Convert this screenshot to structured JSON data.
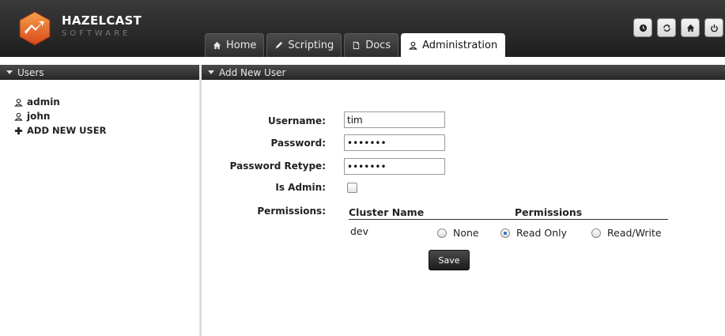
{
  "brand": {
    "name": "HAZELCAST",
    "subtitle": "SOFTWARE"
  },
  "tabs": [
    {
      "label": "Home",
      "icon": "home-icon",
      "active": false
    },
    {
      "label": "Scripting",
      "icon": "pencil-icon",
      "active": false
    },
    {
      "label": "Docs",
      "icon": "document-icon",
      "active": false
    },
    {
      "label": "Administration",
      "icon": "user-icon",
      "active": true
    }
  ],
  "header_buttons": [
    "clock-icon",
    "refresh-icon",
    "home-icon",
    "power-icon"
  ],
  "sidebar": {
    "title": "Users",
    "items": [
      {
        "label": "admin",
        "icon": "user-icon"
      },
      {
        "label": "john",
        "icon": "user-icon"
      },
      {
        "label": "ADD NEW USER",
        "icon": "plus-icon"
      }
    ]
  },
  "main": {
    "title": "Add New User",
    "form": {
      "username_label": "Username:",
      "username_value": "tim",
      "password_label": "Password:",
      "password_value": "•••••••",
      "password_retype_label": "Password Retype:",
      "password_retype_value": "•••••••",
      "is_admin_label": "Is Admin:",
      "is_admin_checked": false,
      "permissions_label": "Permissions:"
    },
    "permissions_table": {
      "col_cluster": "Cluster Name",
      "col_permissions": "Permissions",
      "rows": [
        {
          "cluster": "dev",
          "options": [
            "None",
            "Read Only",
            "Read/Write"
          ],
          "selected": "Read Only"
        }
      ]
    },
    "save_label": "Save"
  },
  "colors": {
    "header_bg": "#2a2a2a",
    "accent_logo": "#e8692a",
    "radio_selected": "#2a6cc8"
  }
}
